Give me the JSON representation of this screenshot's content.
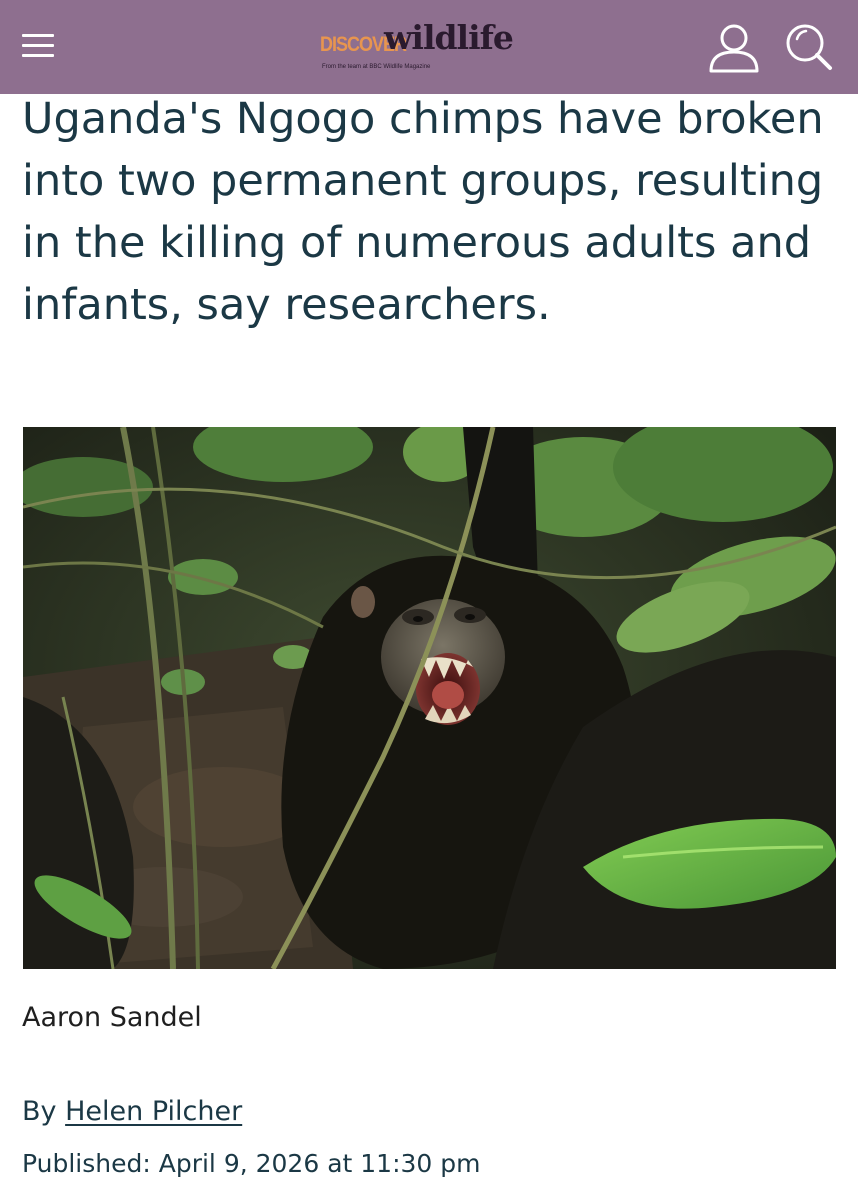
{
  "header": {
    "background_color": "#8e6f8f",
    "menu_icon": "hamburger-menu-icon",
    "logo": {
      "discover": "DISCOVER",
      "wildlife": "wildlife",
      "tagline": "From the team at BBC Wildlife Magazine",
      "discover_color": "#e8954f",
      "wildlife_color": "#2a1a2e"
    },
    "user_icon": "user-account-icon",
    "search_icon": "search-icon"
  },
  "article": {
    "headline": "Uganda's Ngogo chimps have broken into two permanent groups, resulting in the killing of numerous adults and infants, say researchers.",
    "image": {
      "subject": "chimpanzee baring teeth in forest undergrowth",
      "caption": "Aaron Sandel"
    },
    "byline": {
      "prefix": "By",
      "author": "Helen Pilcher"
    },
    "published": "Published: April 9, 2026 at 11:30 pm",
    "text_color": "#1b3845"
  }
}
